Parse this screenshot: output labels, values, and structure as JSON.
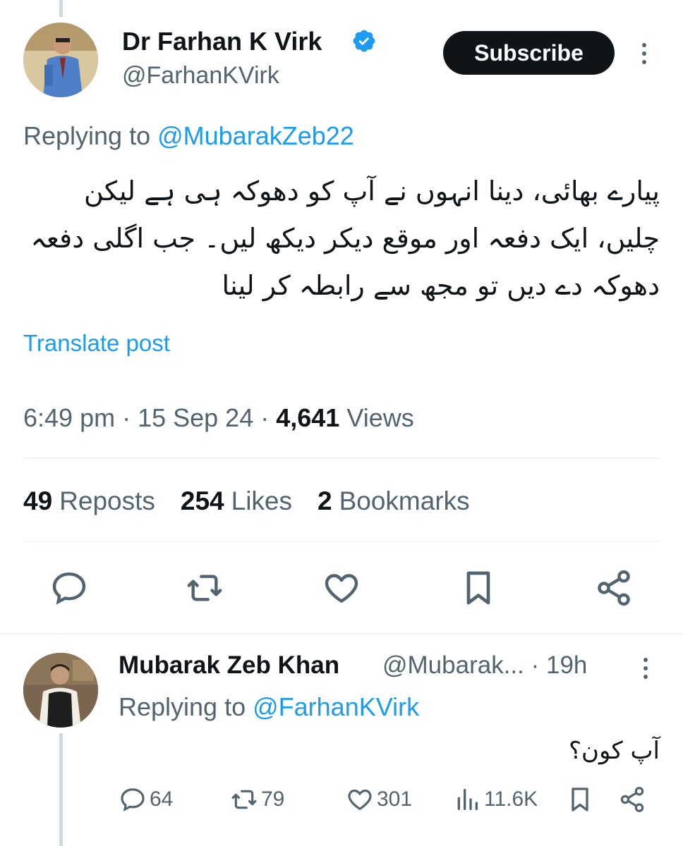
{
  "tweet": {
    "author_name": "Dr Farhan K Virk",
    "author_handle": "@FarhanKVirk",
    "subscribe_label": "Subscribe",
    "replying_prefix": "Replying to ",
    "replying_to": "@MubarakZeb22",
    "text": "پیارے بھائی، دینا انہوں نے آپ کو دھوکہ ہی ہے لیکن چلیں، ایک دفعہ اور موقع دیکر دیکھ لیں۔ جب اگلی دفعہ دھوکہ دے دیں تو مجھ سے رابطہ کر لینا",
    "translate_label": "Translate post",
    "time": "6:49 pm",
    "date": "15 Sep 24",
    "dot": " · ",
    "views_count": "4,641",
    "views_label": "Views",
    "reposts_count": "49",
    "reposts_label": "Reposts",
    "likes_count": "254",
    "likes_label": "Likes",
    "bookmarks_count": "2",
    "bookmarks_label": "Bookmarks"
  },
  "reply": {
    "author_name": "Mubarak Zeb Khan",
    "author_handle": "@Mubarak...",
    "age": "· 19h",
    "replying_prefix": "Replying to ",
    "replying_to": "@FarhanKVirk",
    "text": "آپ کون؟",
    "replies": "64",
    "reposts": "79",
    "likes": "301",
    "views": "11.6K"
  },
  "colors": {
    "accent": "#1d9bf0",
    "text": "#0f1419",
    "secondary": "#536471",
    "divider": "#eff3f4"
  },
  "icons": [
    "verified-badge-icon",
    "more-icon",
    "reply-icon",
    "repost-icon",
    "like-icon",
    "bookmark-icon",
    "share-icon",
    "views-icon"
  ]
}
